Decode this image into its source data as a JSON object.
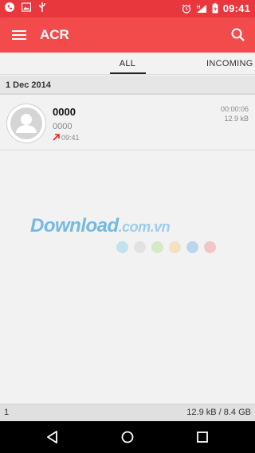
{
  "status_bar": {
    "time": "09:41",
    "left_icons": [
      "phone-icon",
      "image-icon",
      "usb-icon"
    ],
    "right_icons": [
      "alarm-icon",
      "signal-icon",
      "battery-icon"
    ]
  },
  "app_bar": {
    "title": "ACR",
    "background": "#f34b4c"
  },
  "tabs": [
    {
      "label": "ALL",
      "selected": true
    },
    {
      "label": "INCOMING",
      "selected": false
    }
  ],
  "date_header": "1 Dec 2014",
  "calls": [
    {
      "name": "0000",
      "number": "0000",
      "time": "09:41",
      "direction": "outgoing",
      "duration": "00:00:06",
      "size": "12.9 kB"
    }
  ],
  "watermark": {
    "text": "Download",
    "suffix": ".com.vn",
    "dot_colors": [
      "#9fd3ee",
      "#d6d6d6",
      "#bfe0a4",
      "#f6d39a",
      "#8cc0ea",
      "#f0a0a8"
    ]
  },
  "bottom_bar": {
    "count": "1",
    "storage": "12.9 kB / 8.4 GB"
  },
  "nav_bar": [
    "back-button",
    "home-button",
    "recents-button"
  ]
}
